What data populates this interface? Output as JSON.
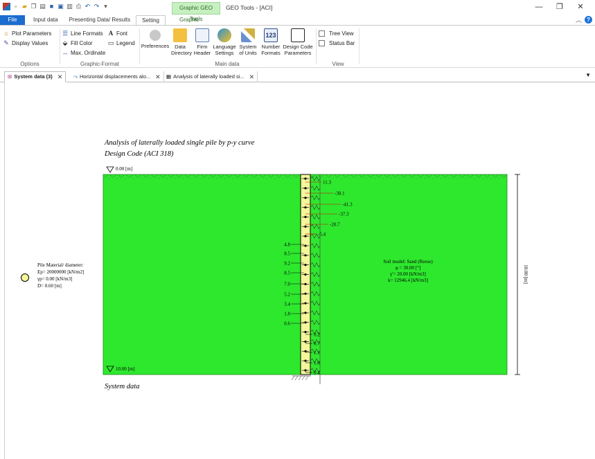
{
  "titlebar": {
    "context_group": "Graphic GEO Tools",
    "app_title": "GEO Tools - [ACI]",
    "quick_access": [
      "app-logo-icon",
      "new-icon",
      "open-icon",
      "copy-icon",
      "paste-icon",
      "save-icon",
      "save-as-icon",
      "print-preview-icon",
      "print-icon",
      "undo-icon",
      "redo-icon",
      "qat-dropdown-icon"
    ]
  },
  "tabs": [
    "File",
    "Input data",
    "Presenting Data/ Results",
    "Setting",
    "Graphic"
  ],
  "ribbon": {
    "options": {
      "label": "Options",
      "plot_parameters": "Plot Parameters",
      "display_values": "Display Values"
    },
    "graphic_format": {
      "label": "Graphic-Format",
      "line_formats": "Line Formats",
      "fill_color": "Fill Color",
      "max_ordinate": "Max. Ordinate",
      "font": "Font",
      "legend": "Legend"
    },
    "main_data": {
      "label": "Main data",
      "preferences": "Preferences",
      "data_directory": [
        "Data",
        "Directory"
      ],
      "firm_header": [
        "Firm",
        "Header"
      ],
      "language_settings": [
        "Language",
        "Settings"
      ],
      "system_of_units": [
        "System",
        "of Units"
      ],
      "number_formats": [
        "Number",
        "Formats"
      ],
      "design_code": [
        "Design Code",
        "Parameters"
      ],
      "number_icon_text": "123"
    },
    "view": {
      "label": "View",
      "tree_view": "Tree View",
      "status_bar": "Status Bar"
    }
  },
  "doc_tabs": [
    {
      "label": "System data (3)",
      "active": true
    },
    {
      "label": "Horizontal displacements alo...",
      "active": false
    },
    {
      "label": "Analysis of laterally loaded si...",
      "active": false
    }
  ],
  "drawing": {
    "title": "Analysis of laterally loaded single pile by p-y curve",
    "subtitle": "Design Code (ACI 318)",
    "top_level": "0.00 [m]",
    "bottom_level": "10.00 [m]",
    "depth_dimension": "10.00 [m]",
    "footer": "System data",
    "pile_material": {
      "heading": "Pile Material/ diameter:",
      "ep": "Ep= 20000000 [kN/m2]",
      "yp": "γp= 0.00 [kN/m3]",
      "d": "D= 0.60 [m]"
    },
    "soil_model": {
      "heading": "Soil model: Sand (Reese)",
      "phi": "φ = 30.00 [°]",
      "gamma": "γ'= 20.00 [kN/m3]",
      "k": "k= 12946.4 [kN/m3]"
    },
    "right_values": [
      "11.3",
      "-30.1",
      "-41.3",
      "-37.3",
      "-20.7",
      "-5.4",
      "0.2",
      "0.7",
      "1.1",
      "1.0",
      "0.4"
    ],
    "left_values": [
      "4.8",
      "8.5",
      "9.2",
      "8.5",
      "7.0",
      "5.2",
      "3.4",
      "1.8",
      "0.6"
    ]
  },
  "colors": {
    "soil": "#2ee82e",
    "pile": "#f5f59a",
    "accent": "#1c6dd0",
    "arrow": "#cc0000"
  }
}
